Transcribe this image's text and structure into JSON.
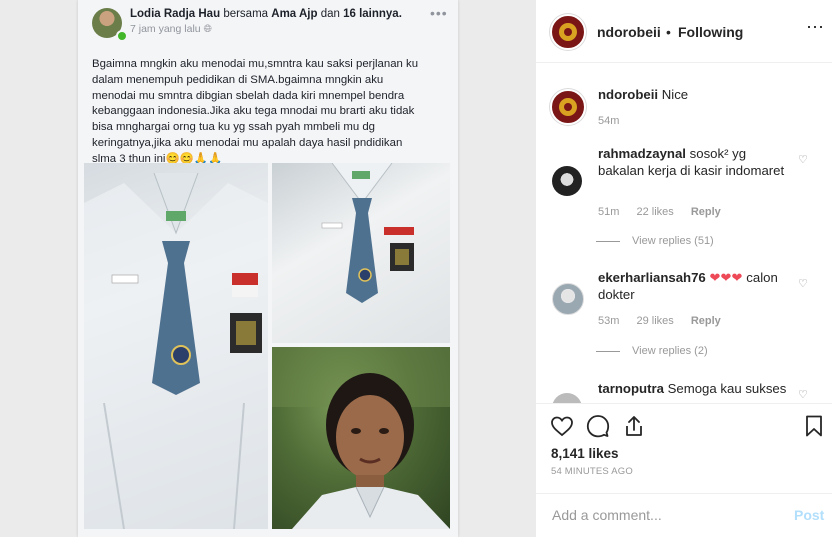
{
  "facebook_post": {
    "author": "Lodia Radja Hau",
    "with_text": "bersama",
    "tagged": "Ama Ajp",
    "and_text": "dan",
    "others": "16 lainnya.",
    "time": "7 jam yang lalu",
    "body": "Bgaimna mngkin aku menodai mu,smntra kau saksi perjlanan ku\ndalam menempuh pedidikan di SMA.bgaimna mngkin aku\nmenodai mu smntra dibgian sbelah dada kiri mnempel bendra\nkebanggaan indonesia.Jika aku tega mnodai mu brarti aku tidak\nbisa mnghargai orng tua ku yg ssah pyah mmbeli mu dg\nkeringatnya,jika aku menodai mu apalah daya hasil pndidikan\nslma 3 thun ini😊😊🙏🙏"
  },
  "header": {
    "username": "ndorobeii",
    "separator": "•",
    "follow_status": "Following",
    "more_icon": "more-horizontal-icon"
  },
  "caption": {
    "username": "ndorobeii",
    "text": "Nice",
    "time": "54m"
  },
  "comments": [
    {
      "username": "rahmadzaynal",
      "text": "sosok² yg bakalan kerja di kasir indomaret",
      "time": "51m",
      "likes": "22 likes",
      "reply": "Reply",
      "view_replies": "View replies (51)"
    },
    {
      "username": "ekerharliansah76",
      "text_hearts": "❤❤❤",
      "text": "calon dokter",
      "time": "53m",
      "likes": "29 likes",
      "reply": "Reply",
      "view_replies": "View replies (2)"
    },
    {
      "username": "tarnoputra",
      "text": "Semoga kau sukses"
    }
  ],
  "actions": {
    "like_icon": "heart-icon",
    "comment_icon": "comment-icon",
    "share_icon": "share-icon",
    "save_icon": "bookmark-icon"
  },
  "likes_count": "8,141 likes",
  "time_ago": "54 MINUTES AGO",
  "add_comment": {
    "placeholder": "Add a comment...",
    "post_label": "Post"
  },
  "colors": {
    "post_button": "#b2dffc",
    "heart_red": "#ed4956",
    "meta_gray": "#999999"
  }
}
